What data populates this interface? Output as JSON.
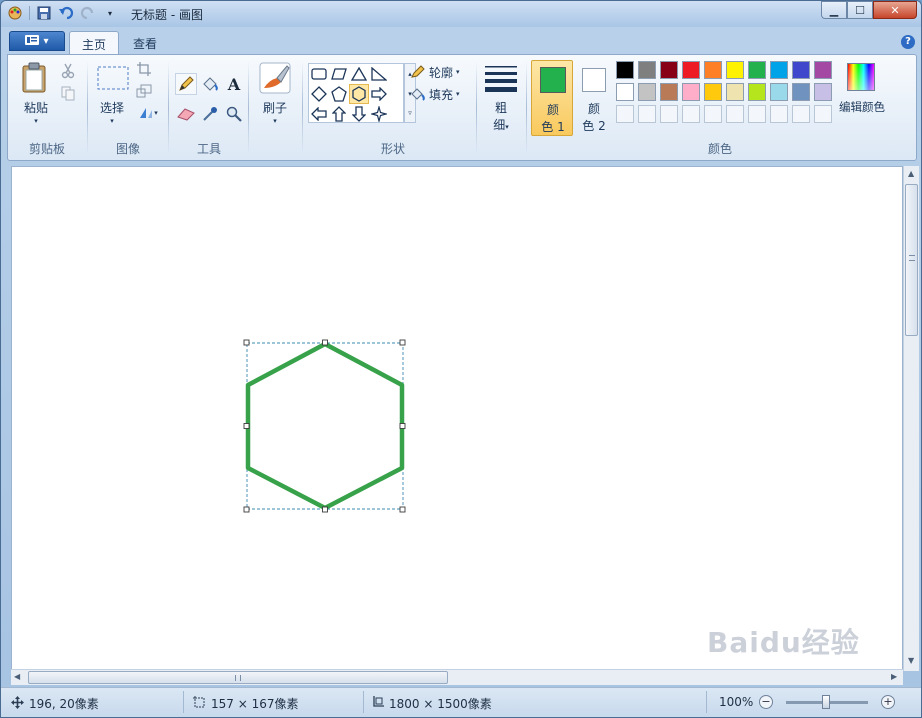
{
  "window": {
    "title": "无标题 - 画图"
  },
  "tabs": [
    {
      "label": "主页",
      "active": true
    },
    {
      "label": "查看",
      "active": false
    }
  ],
  "ribbon": {
    "clipboard": {
      "paste_label": "粘贴",
      "group_label": "剪贴板"
    },
    "image": {
      "select_label": "选择",
      "group_label": "图像"
    },
    "tools": {
      "group_label": "工具"
    },
    "brushes": {
      "label": "刷子"
    },
    "shapes": {
      "outline_label": "轮廓",
      "fill_label": "填充",
      "group_label": "形状"
    },
    "size": {
      "label_top": "粗",
      "label_bottom": "细"
    },
    "colors": {
      "color1_top": "颜",
      "color1_bottom": "色 1",
      "color2_top": "颜",
      "color2_bottom": "色 2",
      "edit_label": "编辑颜色",
      "group_label": "颜色",
      "color1_value": "#22b14c",
      "color2_value": "#ffffff",
      "palette_row1": [
        "#000000",
        "#7f7f7f",
        "#880015",
        "#ed1c24",
        "#ff7f27",
        "#fff200",
        "#22b14c",
        "#00a2e8",
        "#3f48cc",
        "#a349a4"
      ],
      "palette_row2": [
        "#ffffff",
        "#c3c3c3",
        "#b97a57",
        "#ffaec9",
        "#ffc90e",
        "#efe4b0",
        "#b5e61d",
        "#99d9ea",
        "#7092be",
        "#c8bfe7"
      ]
    }
  },
  "canvas": {
    "shape": "hexagon",
    "outline_color": "#37a24a"
  },
  "status": {
    "cursor_pos": "196, 20像素",
    "selection_size": "157 × 167像素",
    "image_size": "1800 × 1500像素",
    "zoom": "100%"
  },
  "watermark": "Baidu经验"
}
